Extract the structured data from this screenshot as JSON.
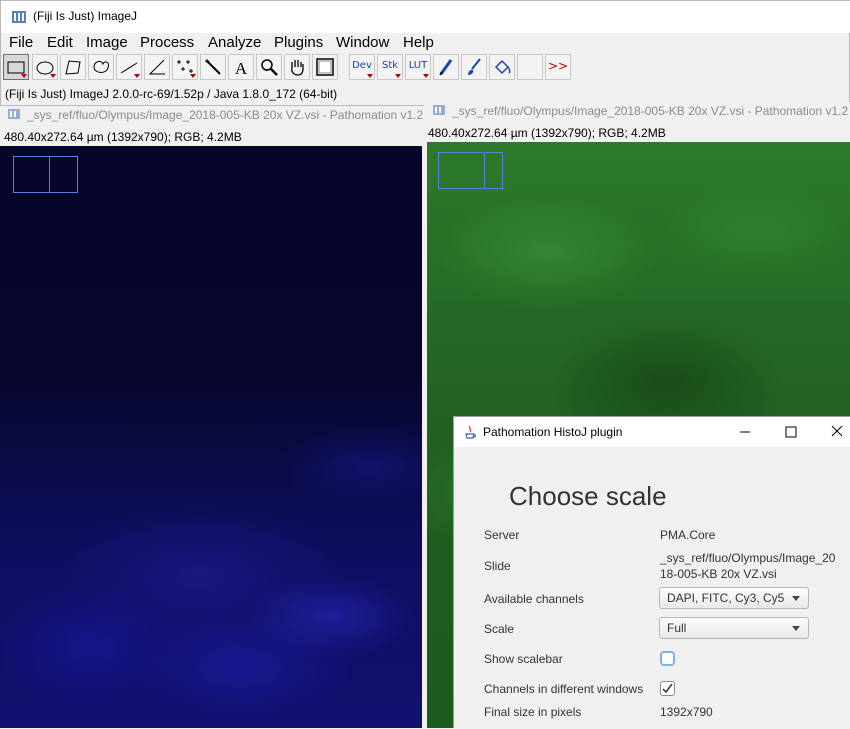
{
  "main_window": {
    "title": "(Fiji Is Just) ImageJ",
    "menu": [
      "File",
      "Edit",
      "Image",
      "Process",
      "Analyze",
      "Plugins",
      "Window",
      "Help"
    ],
    "toolbar": {
      "tools": [
        "rectangle-tool",
        "oval-tool",
        "polygon-tool",
        "freehand-tool",
        "line-tool",
        "angle-tool",
        "multipoint-tool",
        "wand-tool",
        "text-tool",
        "magnifier-tool",
        "hand-tool",
        "color-picker-tool"
      ],
      "dev_label": "Dev",
      "stk_label": "Stk",
      "lut_label": "LUT",
      "more_label": ">>"
    },
    "status": "(Fiji Is Just) ImageJ 2.0.0-rc-69/1.52p / Java 1.8.0_172 (64-bit)"
  },
  "image_windows": [
    {
      "title": "_sys_ref/fluo/Olympus/Image_2018-005-KB 20x VZ.vsi - Pathomation v1.2",
      "info": "480.40x272.64 µm (1392x790); RGB; 4.2MB"
    },
    {
      "title": "_sys_ref/fluo/Olympus/Image_2018-005-KB 20x VZ.vsi - Pathomation v1.2",
      "info": "480.40x272.64 µm (1392x790); RGB; 4.2MB"
    }
  ],
  "dialog": {
    "title": "Pathomation HistoJ plugin",
    "heading": "Choose scale",
    "server_label": "Server",
    "server_value": "PMA.Core",
    "slide_label": "Slide",
    "slide_value_line1": "_sys_ref/fluo/Olympus/Image_20",
    "slide_value_line2": "18-005-KB 20x VZ.vsi",
    "channels_label": "Available channels",
    "channels_value": "DAPI, FITC, Cy3, Cy5",
    "scale_label": "Scale",
    "scale_value": "Full",
    "scalebar_label": "Show scalebar",
    "scalebar_checked": false,
    "different_windows_label": "Channels in different windows",
    "different_windows_checked": true,
    "final_size_label": "Final size in pixels",
    "final_size_value": "1392x790"
  },
  "colors": {
    "dapi_channel": "#0b0b58",
    "fitc_channel": "#236d24",
    "navigator_box": "#5f7fdc"
  }
}
